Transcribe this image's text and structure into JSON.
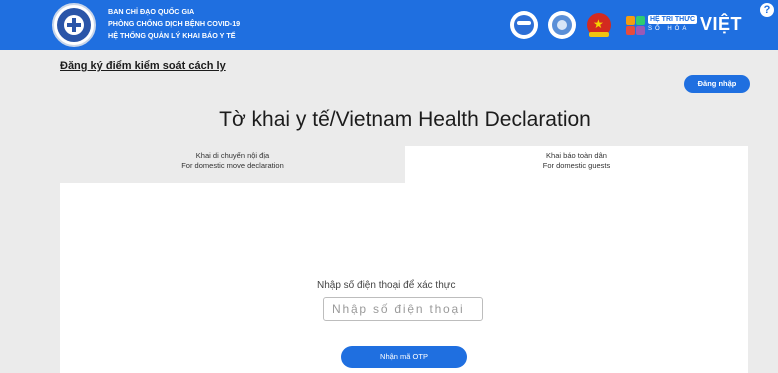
{
  "header": {
    "title_line1": "BAN CHỈ ĐẠO QUỐC GIA",
    "title_line2": "PHÒNG CHỐNG DỊCH BỆNH COVID-19",
    "title_line3": "HỆ THỐNG QUẢN LÝ KHAI BÁO Y TẾ",
    "brand_top": "HỆ TRI THỨC",
    "brand_sub": "SỐ HÓA",
    "brand_main": "VIỆT",
    "help": "?"
  },
  "nav": {
    "register_link": "Đăng ký điểm kiểm soát cách ly",
    "login_button": "Đăng nhập"
  },
  "main": {
    "title": "Tờ khai y tế/Vietnam Health Declaration",
    "tabs": [
      {
        "line1": "Khai di chuyển nội địa",
        "line2": "For domestic move declaration"
      },
      {
        "line1": "Khai báo toàn dân",
        "line2": "For domestic guests"
      }
    ],
    "verify_label": "Nhập số điện thoại để xác thực",
    "phone_placeholder": "Nhập số điện thoại",
    "otp_button": "Nhận mã OTP"
  },
  "colors": {
    "primary": "#1f6fe0",
    "background": "#ebebeb"
  }
}
